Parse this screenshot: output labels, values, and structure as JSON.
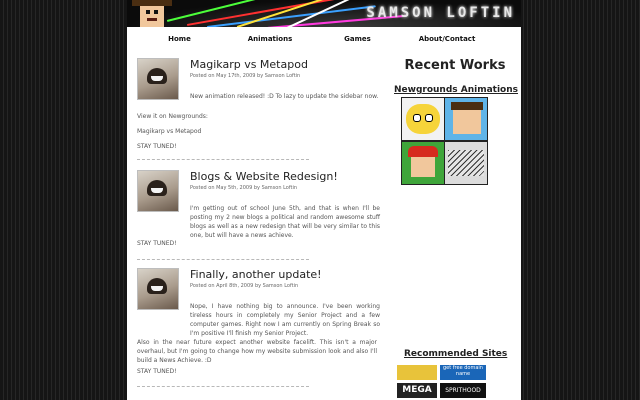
{
  "header": {
    "logo_text": "SAMSON LOFTIN"
  },
  "nav": {
    "items": [
      "Home",
      "Animations",
      "Games",
      "About/Contact"
    ]
  },
  "posts": [
    {
      "title": "Magikarp vs Metapod",
      "meta": "Posted on May 17th, 2009 by Samson Loftin",
      "body": "New animation released! :D To lazy to update the sidebar now.",
      "extra": [
        "View it on Newgrounds:",
        "Magikarp vs Metapod",
        "STAY TUNED!"
      ]
    },
    {
      "title": "Blogs & Website Redesign!",
      "meta": "Posted on May 5th, 2009 by Samson Loftin",
      "body": "I'm getting out of school June 5th, and that is when I'll be posting my 2 new blogs a political and random awesome stuff blogs as well as a new redesign that will be very similar to this one, but will have a news achieve.",
      "extra": [
        "STAY TUNED!"
      ]
    },
    {
      "title": "Finally, another update!",
      "meta": "Posted on April 8th, 2009 by Samson Loftin",
      "body": "Nope, I have nothing big to announce. I've been working tireless hours in completely my Senior Project and a few computer games. Right now I am currently on Spring Break so I'm positive I'll finish my Senior Project.",
      "extra": [
        "Also in the near future expect another website facelift. This isn't a major overhaul, but I'm going to change how my website submission look and also I'll build a News Achieve. :D",
        "STAY TUNED!"
      ]
    }
  ],
  "sidebar": {
    "title": "Recent Works",
    "subtitle": "Newgrounds Animations",
    "recommended_title": "Recommended Sites",
    "banners": [
      "get free domain name",
      "MEGA",
      "SPRITHOOD"
    ]
  },
  "colors": {
    "streak_green": "#4cff3a",
    "streak_red": "#ff3030",
    "streak_blue": "#3aa0ff",
    "streak_yellow": "#ffe23a",
    "streak_magenta": "#ff3adf"
  }
}
